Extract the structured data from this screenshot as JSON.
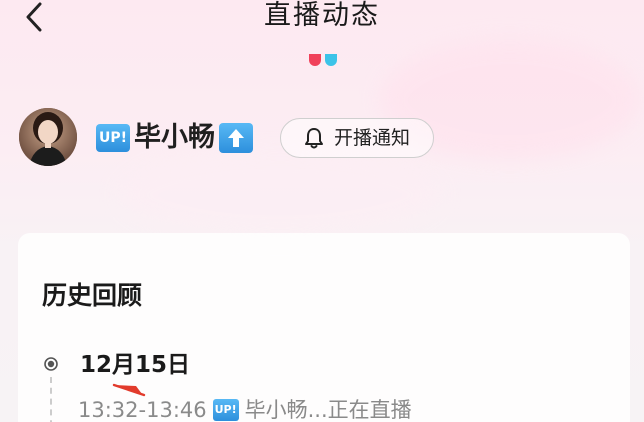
{
  "header": {
    "title": "直播动态"
  },
  "profile": {
    "badge": "UP!",
    "name": "毕小畅",
    "notify_label": "开播通知"
  },
  "history": {
    "section_title": "历史回顾",
    "entries": [
      {
        "date": "12月15日",
        "time": "13:32-13:46",
        "badge": "UP!",
        "text": "毕小畅...正在直播"
      }
    ]
  },
  "colors": {
    "brand_red": "#f0415a",
    "brand_blue": "#3cc3e8",
    "up_badge": "#2d8fdc"
  },
  "icons": [
    "back-arrow-icon",
    "bell-icon",
    "up-arrow-icon",
    "timeline-dot-icon"
  ]
}
